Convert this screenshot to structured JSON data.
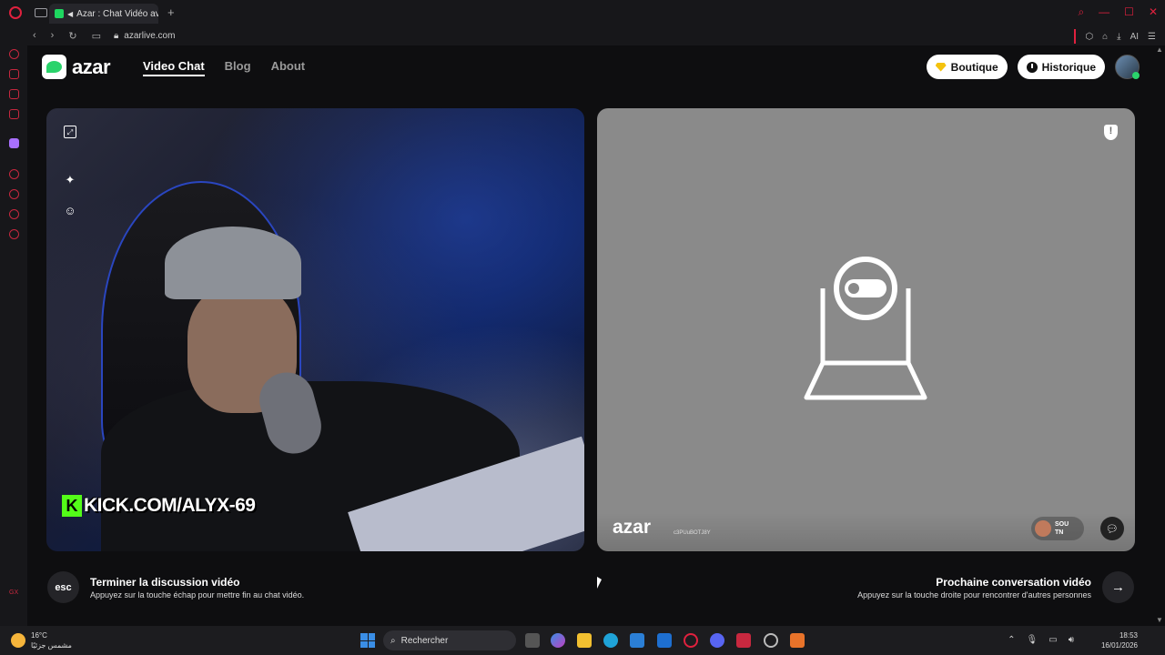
{
  "browser": {
    "tab_title": "Azar : Chat Vidéo avec",
    "url": "azarlive.com",
    "ai_label": "AI"
  },
  "nav": {
    "logo_text": "azar",
    "items": [
      {
        "label": "Video Chat",
        "active": true
      },
      {
        "label": "Blog",
        "active": false
      },
      {
        "label": "About",
        "active": false
      }
    ],
    "boutique_label": "Boutique",
    "historique_label": "Historique"
  },
  "local_video": {
    "overlay_text": "KICK.COM/ALYX-69",
    "overlay_logo": "K"
  },
  "remote_video": {
    "watermark": "azar",
    "id_text": "c3PUuBOTJ8Y",
    "peer_name": "SOU",
    "peer_country": "TN"
  },
  "footer": {
    "esc_label": "esc",
    "end_title": "Terminer la discussion vidéo",
    "end_subtitle": "Appuyez sur la touche échap pour mettre fin au chat vidéo.",
    "next_title": "Prochaine conversation vidéo",
    "next_subtitle": "Appuyez sur la touche droite pour rencontrer d'autres personnes"
  },
  "taskbar": {
    "temperature": "16°C",
    "weather_desc": "مشمس جزئيًا",
    "search_placeholder": "Rechercher",
    "time": "18:53",
    "date": "16/01/2026"
  }
}
